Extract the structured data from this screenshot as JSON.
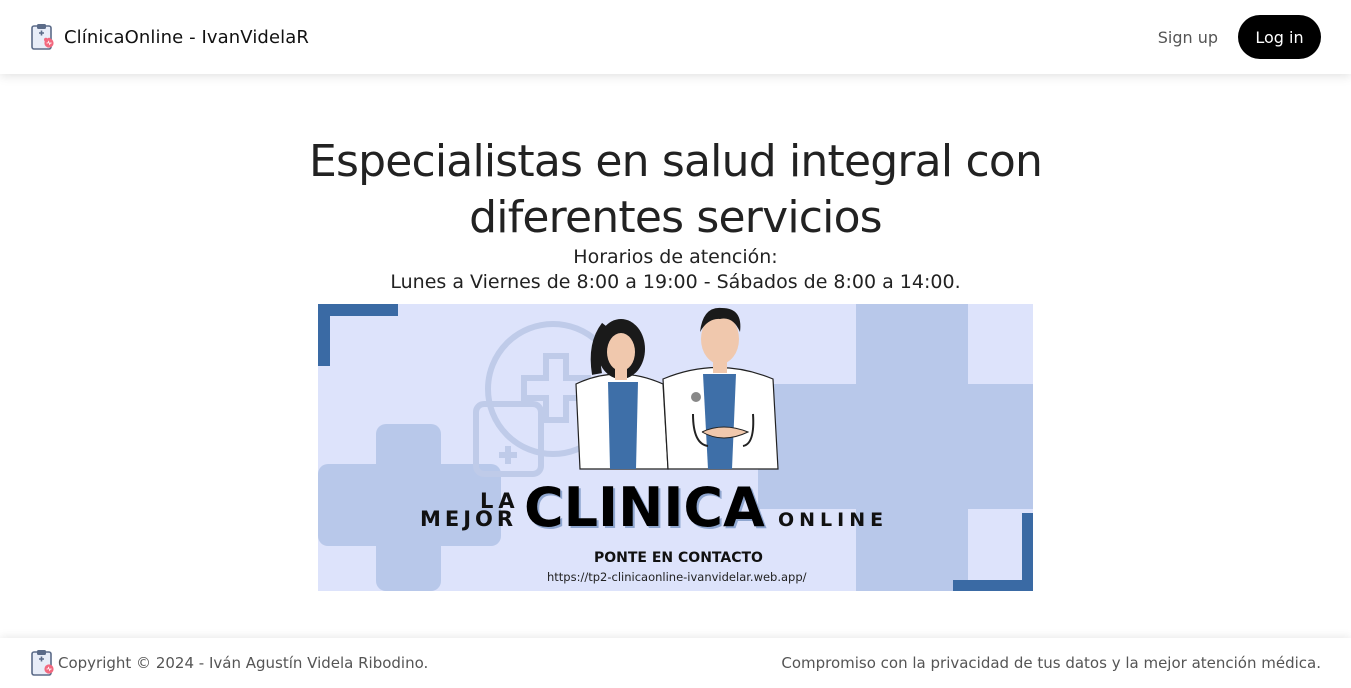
{
  "header": {
    "brand": "ClínicaOnline - IvanVidelaR",
    "signup_label": "Sign up",
    "login_label": "Log in"
  },
  "hero": {
    "title": "Especialistas en salud integral con diferentes servicios",
    "hours_label": "Horarios de atención:",
    "hours_text": "Lunes a Viernes de 8:00 a 19:00 - Sábados de 8:00 a 14:00."
  },
  "banner": {
    "word_la": "LA",
    "word_mejor": "MEJOR",
    "word_clinica": "CLINICA",
    "word_online": "ONLINE",
    "contact": "PONTE EN CONTACTO",
    "url": "https://tp2-clinicaonline-ivanvidelar.web.app/"
  },
  "footer": {
    "copyright": "Copyright © 2024 - Iván Agustín Videla Ribodino.",
    "tagline": "Compromiso con la privacidad de tus datos y la mejor atención médica."
  },
  "colors": {
    "banner_bg": "#dde3fb",
    "banner_cross": "#b8c8ea",
    "banner_frame": "#3a6aa4",
    "scrub": "#4a7aaa",
    "button_bg": "#000000"
  }
}
